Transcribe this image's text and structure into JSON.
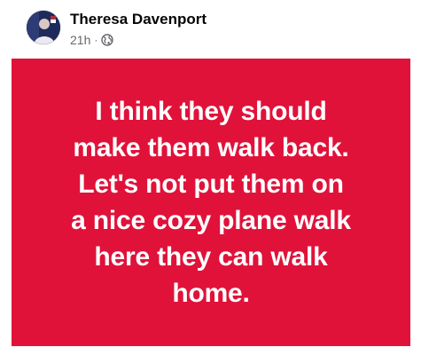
{
  "post": {
    "author": "Theresa Davenport",
    "timestamp": "21h",
    "separator": "·",
    "audience_icon": "globe-icon",
    "avatar": "profile-photo",
    "background_color": "#e0123a",
    "text_lines": [
      "I think they should",
      "make them walk back.",
      "Let's not put them on",
      "a nice cozy plane walk",
      "here they can walk",
      "home."
    ]
  }
}
